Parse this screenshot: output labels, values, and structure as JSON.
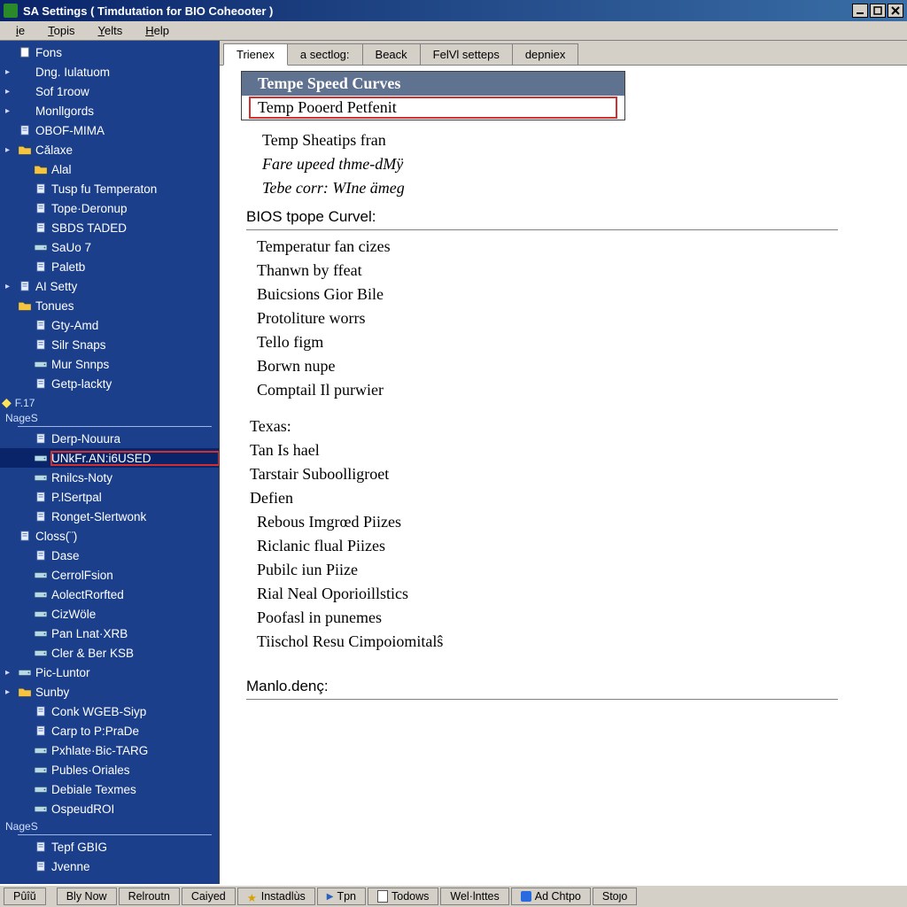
{
  "window": {
    "title": "SA  Settings  ( Timdutation for BIO  Coheooter )"
  },
  "menubar": [
    {
      "label": "ie",
      "pre": "",
      "u": "i",
      "post": "e"
    },
    {
      "label": "Topis",
      "pre": "",
      "u": "T",
      "post": "opis"
    },
    {
      "label": "Yelts",
      "pre": "",
      "u": "Y",
      "post": "elts"
    },
    {
      "label": "Help",
      "pre": "",
      "u": "H",
      "post": "elp"
    }
  ],
  "sidebar_top": [
    {
      "d": 1,
      "arrow": "",
      "icon": "doc",
      "label": "Fons"
    },
    {
      "d": 1,
      "arrow": "▸",
      "icon": "",
      "label": "Dng. Iulatuom"
    },
    {
      "d": 1,
      "arrow": "▸",
      "icon": "",
      "label": "Sof  1roow"
    },
    {
      "d": 1,
      "arrow": "▸",
      "icon": "",
      "label": "Monllgords"
    },
    {
      "d": 1,
      "arrow": "",
      "icon": "page",
      "label": "OBOF-MIMA"
    },
    {
      "d": 1,
      "arrow": "▸",
      "icon": "folder",
      "label": "Cǎlaxe"
    },
    {
      "d": 2,
      "arrow": "",
      "icon": "folder",
      "label": "Alal"
    },
    {
      "d": 2,
      "arrow": "",
      "icon": "page",
      "label": "Tusp fu  Temperaton"
    },
    {
      "d": 2,
      "arrow": "",
      "icon": "page",
      "label": "Tope·Deronup"
    },
    {
      "d": 2,
      "arrow": "",
      "icon": "page",
      "label": "SBDS  TADED"
    },
    {
      "d": 2,
      "arrow": "",
      "icon": "drive",
      "label": "SaUo 7"
    },
    {
      "d": 2,
      "arrow": "",
      "icon": "page",
      "label": "Paletb"
    },
    {
      "d": 1,
      "arrow": "▸",
      "icon": "page",
      "label": "AI  Setty"
    },
    {
      "d": 1,
      "arrow": "",
      "icon": "folder",
      "label": "Tonues"
    },
    {
      "d": 2,
      "arrow": "",
      "icon": "page",
      "label": "Gty-Amd"
    },
    {
      "d": 2,
      "arrow": "",
      "icon": "page",
      "label": "Silr  Snaps"
    },
    {
      "d": 2,
      "arrow": "",
      "icon": "drive",
      "label": "Mur  Snnps"
    },
    {
      "d": 2,
      "arrow": "",
      "icon": "page",
      "label": "Getp-lackty"
    }
  ],
  "sidebar_f17": "F.17",
  "sidebar_nages": "NageS",
  "sidebar_mid": [
    {
      "d": 2,
      "arrow": "",
      "icon": "page",
      "label": "Derp-Nouura"
    },
    {
      "d": 2,
      "arrow": "",
      "icon": "drive",
      "label": "UNkFr.AN:i6USED",
      "sel": true
    },
    {
      "d": 2,
      "arrow": "",
      "icon": "drive",
      "label": "Rnilcs-Noty"
    },
    {
      "d": 2,
      "arrow": "",
      "icon": "page",
      "label": "P.lSertpal"
    },
    {
      "d": 2,
      "arrow": "",
      "icon": "page",
      "label": "Ronget-Slertwonk"
    },
    {
      "d": 1,
      "arrow": "",
      "icon": "page",
      "label": "Closs(¨)"
    },
    {
      "d": 2,
      "arrow": "",
      "icon": "page",
      "label": "Dase"
    },
    {
      "d": 2,
      "arrow": "",
      "icon": "drive",
      "label": "CerrolFsion"
    },
    {
      "d": 2,
      "arrow": "",
      "icon": "drive",
      "label": "AolectRorfted"
    },
    {
      "d": 2,
      "arrow": "",
      "icon": "drive",
      "label": "CizWöle"
    },
    {
      "d": 2,
      "arrow": "",
      "icon": "drive",
      "label": "Pan  Lnat·XRB"
    },
    {
      "d": 2,
      "arrow": "",
      "icon": "drive",
      "label": "Cler & Ber KSB"
    },
    {
      "d": 1,
      "arrow": "▸",
      "icon": "drive",
      "label": "Pic-Luntor"
    },
    {
      "d": 1,
      "arrow": "▸",
      "icon": "folder",
      "label": "Sunby"
    },
    {
      "d": 2,
      "arrow": "",
      "icon": "page",
      "label": "Conk WGEB-Siyp"
    },
    {
      "d": 2,
      "arrow": "",
      "icon": "page",
      "label": "Carp  to P:PraDe"
    },
    {
      "d": 2,
      "arrow": "",
      "icon": "drive",
      "label": "Pxhlate·Bic-TARG"
    },
    {
      "d": 2,
      "arrow": "",
      "icon": "drive",
      "label": "Publes·Oriales"
    },
    {
      "d": 2,
      "arrow": "",
      "icon": "drive",
      "label": "Debiale  Texmes"
    },
    {
      "d": 2,
      "arrow": "",
      "icon": "drive",
      "label": "OspeudROI"
    }
  ],
  "sidebar_nages2": "NageS",
  "sidebar_bot": [
    {
      "d": 2,
      "arrow": "",
      "icon": "page",
      "label": "Tepf  GBIG"
    },
    {
      "d": 2,
      "arrow": "",
      "icon": "page",
      "label": "Jvenne"
    }
  ],
  "tabs": [
    {
      "label": "Trienex",
      "active": true
    },
    {
      "label": "a  sectlog:",
      "active": false
    },
    {
      "label": "Beack",
      "active": false
    },
    {
      "label": "FelVl  setteps",
      "active": false
    },
    {
      "label": "depniex",
      "active": false
    }
  ],
  "topbox": [
    {
      "label": "Tempe  Speed  Curves",
      "head": true
    },
    {
      "label": "Temp  Pooerd  Petfenit",
      "hl": true
    }
  ],
  "toplines": [
    "Temp  Sheatips   fran",
    "Fare  upeed  thme-dMÿ",
    "Tebe  corr:  WIne  ämeg"
  ],
  "section1": "BIOS  tpope  Curvel:",
  "list1": [
    "Temperatur  fan  cizes",
    "Thanwn  by  ffeat",
    "Buicsions  Gior  Bile",
    "Protoliture  worrs",
    "Tello  figm",
    "Borwn  nupe",
    "Comptail  Il  purwier"
  ],
  "list2_head": "Texas:",
  "list2": [
    "Tan Is  hael",
    "Tarstair  Suboolligroet",
    "Defien",
    "Rebous  Imgrœd  Piizes",
    "Riclanic  flual  Piizes",
    "Pubilc  iun  Piize",
    "Rial  Neal  Oporioillstics",
    "Poofasl  in  punemes",
    "Tiischol  Resu  Cimpoiomitalŝ"
  ],
  "section2": "Manlo.denç:",
  "taskbar": [
    {
      "label": "Pûîŭ",
      "icon": ""
    },
    {
      "label": "Bly Now",
      "icon": ""
    },
    {
      "label": "Relroutn",
      "icon": ""
    },
    {
      "label": "Caiyed",
      "icon": ""
    },
    {
      "label": "Instadlùs",
      "icon": "star"
    },
    {
      "label": "Tpn",
      "icon": "play"
    },
    {
      "label": "Todows",
      "icon": "doc"
    },
    {
      "label": "Wel·lnttes",
      "icon": ""
    },
    {
      "label": "Ad Chtpo",
      "icon": "blue"
    },
    {
      "label": "Stoȷo",
      "icon": ""
    }
  ]
}
